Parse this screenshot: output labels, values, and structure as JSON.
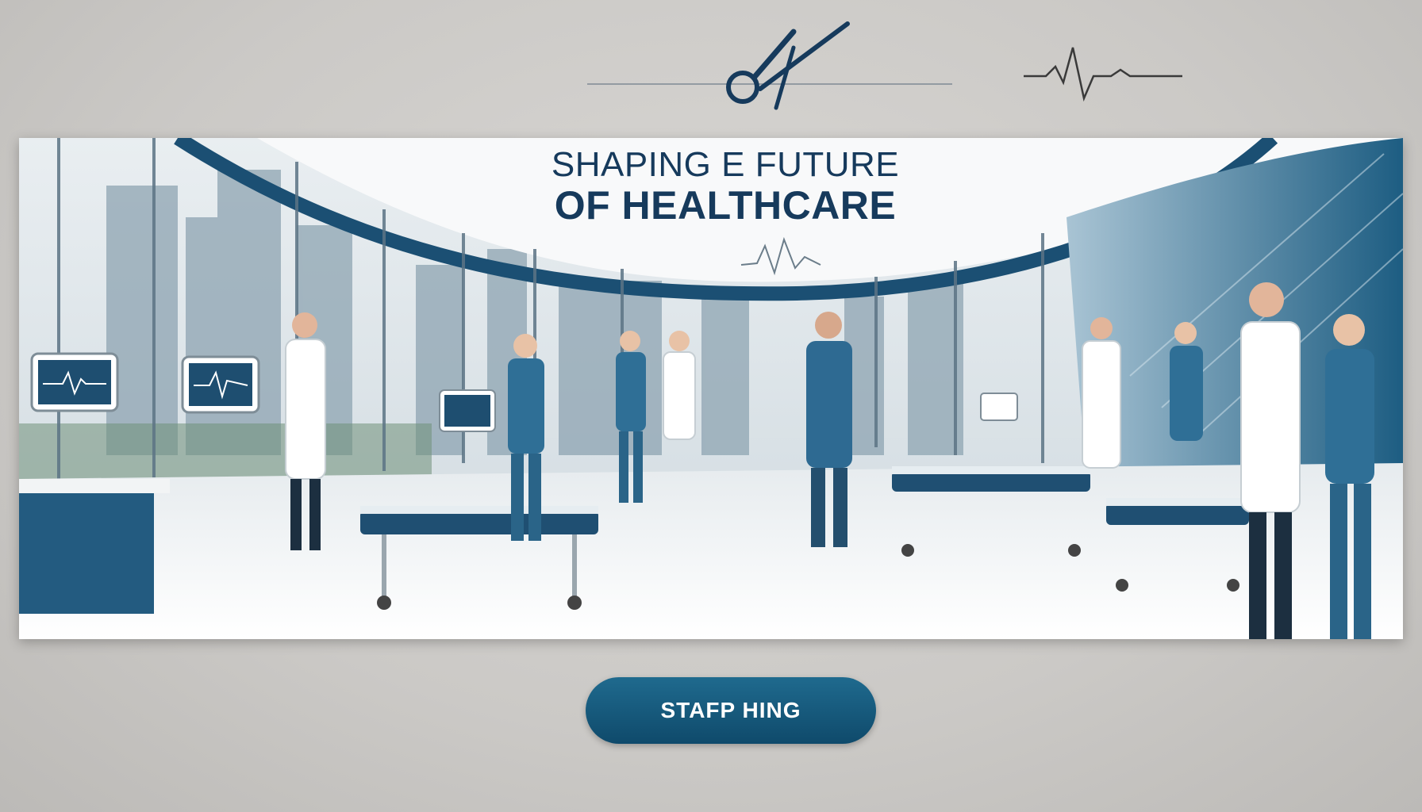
{
  "banner": {
    "headline_line1": "SHAPING E FUTURE",
    "headline_line2": "OF HEALTHCARE"
  },
  "cta": {
    "label": "STAFP HING"
  },
  "icons": {
    "top_left": "surgical-clamp-icon",
    "top_right": "heartbeat-line-icon"
  },
  "colors": {
    "background": "#cbc9c6",
    "navy": "#163a5c",
    "teal": "#1f6a8e",
    "scrubs": "#2f6f96"
  }
}
